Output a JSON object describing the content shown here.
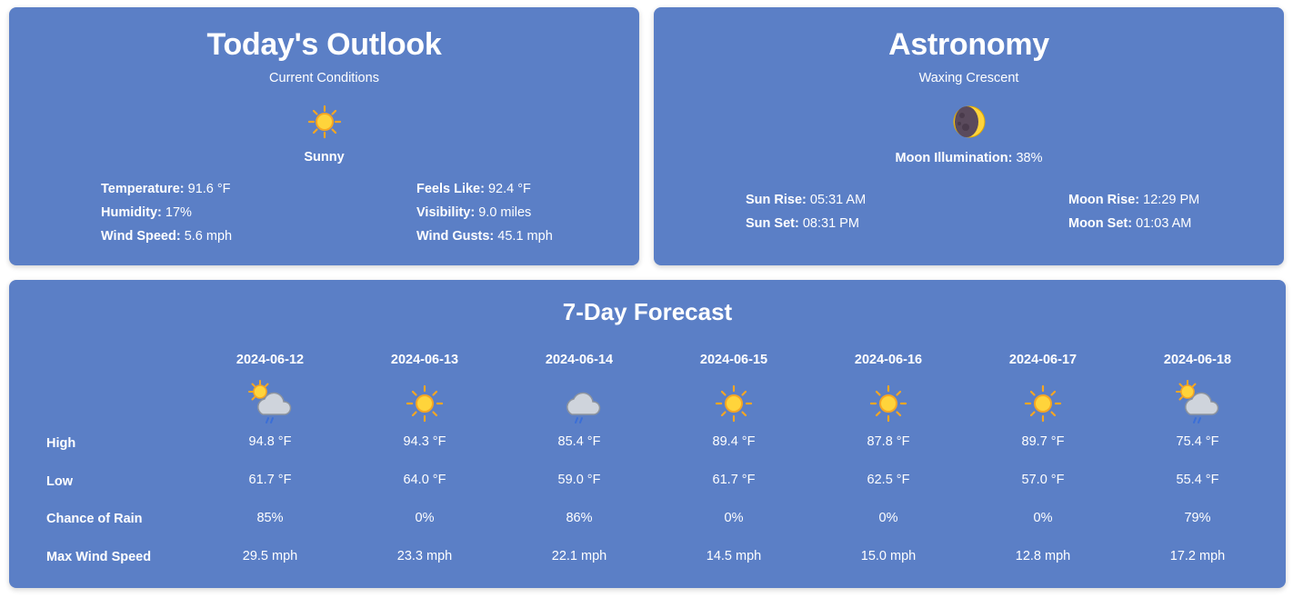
{
  "outlook": {
    "title": "Today's Outlook",
    "subtitle": "Current Conditions",
    "condition_icon": "sun-icon",
    "condition": "Sunny",
    "stats": {
      "temperature_label": "Temperature:",
      "temperature": "91.6 °F",
      "humidity_label": "Humidity:",
      "humidity": "17%",
      "wind_speed_label": "Wind Speed:",
      "wind_speed": "5.6 mph",
      "feels_like_label": "Feels Like:",
      "feels_like": "92.4 °F",
      "visibility_label": "Visibility:",
      "visibility": "9.0 miles",
      "wind_gusts_label": "Wind Gusts:",
      "wind_gusts": "45.1 mph"
    }
  },
  "astronomy": {
    "title": "Astronomy",
    "subtitle": "Waxing Crescent",
    "moon_icon": "crescent-moon-icon",
    "illumination_label": "Moon Illumination:",
    "illumination": "38%",
    "sun_rise_label": "Sun Rise:",
    "sun_rise": "05:31 AM",
    "sun_set_label": "Sun Set:",
    "sun_set": "08:31 PM",
    "moon_rise_label": "Moon Rise:",
    "moon_rise": "12:29 PM",
    "moon_set_label": "Moon Set:",
    "moon_set": "01:03 AM"
  },
  "forecast": {
    "title": "7-Day Forecast",
    "row_labels": [
      "High",
      "Low",
      "Chance of Rain",
      "Max Wind Speed"
    ],
    "days": [
      {
        "date": "2024-06-12",
        "icon": "sun-cloud-rain-icon",
        "high": "94.8 °F",
        "low": "61.7 °F",
        "rain": "85%",
        "wind": "29.5 mph"
      },
      {
        "date": "2024-06-13",
        "icon": "sun-icon",
        "high": "94.3 °F",
        "low": "64.0 °F",
        "rain": "0%",
        "wind": "23.3 mph"
      },
      {
        "date": "2024-06-14",
        "icon": "cloud-rain-icon",
        "high": "85.4 °F",
        "low": "59.0 °F",
        "rain": "86%",
        "wind": "22.1 mph"
      },
      {
        "date": "2024-06-15",
        "icon": "sun-icon",
        "high": "89.4 °F",
        "low": "61.7 °F",
        "rain": "0%",
        "wind": "14.5 mph"
      },
      {
        "date": "2024-06-16",
        "icon": "sun-icon",
        "high": "87.8 °F",
        "low": "62.5 °F",
        "rain": "0%",
        "wind": "15.0 mph"
      },
      {
        "date": "2024-06-17",
        "icon": "sun-icon",
        "high": "89.7 °F",
        "low": "57.0 °F",
        "rain": "0%",
        "wind": "12.8 mph"
      },
      {
        "date": "2024-06-18",
        "icon": "sun-cloud-rain-icon",
        "high": "75.4 °F",
        "low": "55.4 °F",
        "rain": "79%",
        "wind": "17.2 mph"
      }
    ]
  },
  "colors": {
    "card_bg": "#5b7fc6",
    "text": "#ffffff",
    "sun": "#f7c21b",
    "cloud": "#c9ced6"
  }
}
